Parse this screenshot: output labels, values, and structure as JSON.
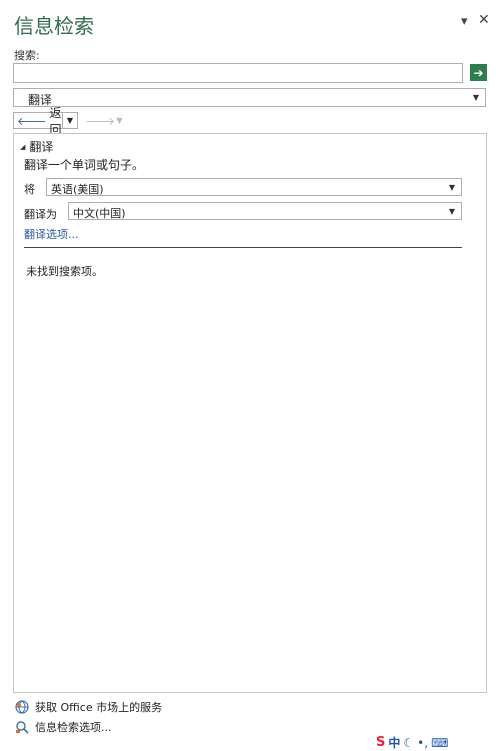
{
  "pane": {
    "title": "信息检索"
  },
  "search": {
    "label": "搜索:",
    "value": "",
    "placeholder": ""
  },
  "source_select": {
    "value": "翻译"
  },
  "nav": {
    "back_label": "返回"
  },
  "section": {
    "title": "翻译",
    "intro": "翻译一个单词或句子。"
  },
  "translate": {
    "from_label": "将",
    "from_value": "英语(美国)",
    "to_label": "翻译为",
    "to_value": "中文(中国)",
    "options_link": "翻译选项..."
  },
  "results": {
    "message": "未找到搜索项。"
  },
  "footer": {
    "market_label": "获取 Office 市场上的服务",
    "options_label": "信息检索选项..."
  },
  "ime": {
    "zh": "中"
  },
  "colors": {
    "title_green": "#2f6f49",
    "go_green": "#2e7d4f",
    "link_blue": "#2a5aa0"
  }
}
